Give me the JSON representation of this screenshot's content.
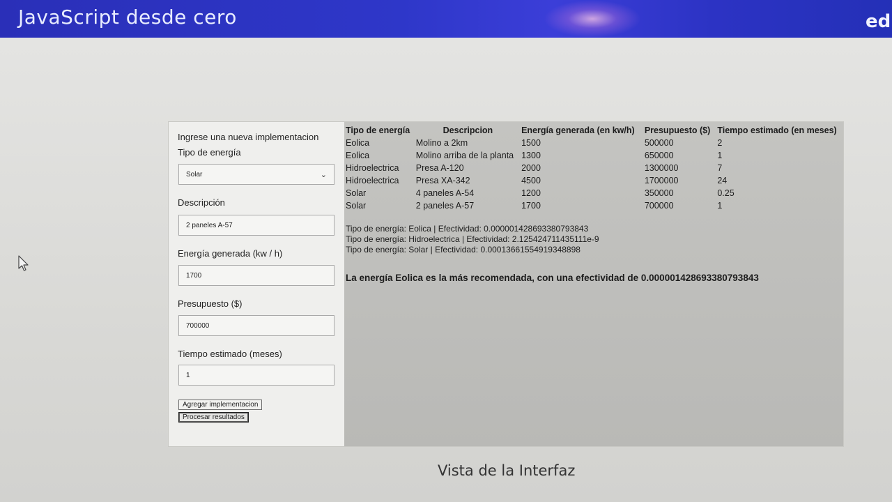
{
  "header": {
    "title": "JavaScript desde cero",
    "brand": "ed"
  },
  "form": {
    "heading": "Ingrese una nueva implementacion",
    "tipo_label": "Tipo de energía",
    "tipo_value": "Solar",
    "descripcion_label": "Descripción",
    "descripcion_value": "2 paneles A-57",
    "energia_label": "Energía generada (kw / h)",
    "energia_value": "1700",
    "presupuesto_label": "Presupuesto ($)",
    "presupuesto_value": "700000",
    "tiempo_label": "Tiempo estimado (meses)",
    "tiempo_value": "1",
    "add_button": "Agregar implementacion",
    "process_button": "Procesar resultados"
  },
  "table": {
    "headers": [
      "Tipo de energía",
      "Descripcion",
      "Energía generada (en kw/h)",
      "Presupuesto ($)",
      "Tiempo estimado (en meses)"
    ],
    "rows": [
      [
        "Eolica",
        "Molino a 2km",
        "1500",
        "500000",
        "2"
      ],
      [
        "Eolica",
        "Molino arriba de la planta",
        "1300",
        "650000",
        "1"
      ],
      [
        "Hidroelectrica",
        "Presa A-120",
        "2000",
        "1300000",
        "7"
      ],
      [
        "Hidroelectrica",
        "Presa XA-342",
        "4500",
        "1700000",
        "24"
      ],
      [
        "Solar",
        "4 paneles A-54",
        "1200",
        "350000",
        "0.25"
      ],
      [
        "Solar",
        "2 paneles A-57",
        "1700",
        "700000",
        "1"
      ]
    ]
  },
  "effectiveness": [
    "Tipo de energía: Eolica | Efectividad: 0.000001428693380793843",
    "Tipo de energía: Hidroelectrica | Efectividad: 2.125424711435111e-9",
    "Tipo de energía: Solar | Efectividad: 0.00013661554919348898"
  ],
  "recommendation": "La energía Eolica es la más recomendada, con una efectividad de 0.000001428693380793843",
  "caption": "Vista de la Interfaz",
  "colors": {
    "header_bar": "#2e37c9",
    "results_bg": "#c0c0bd"
  }
}
